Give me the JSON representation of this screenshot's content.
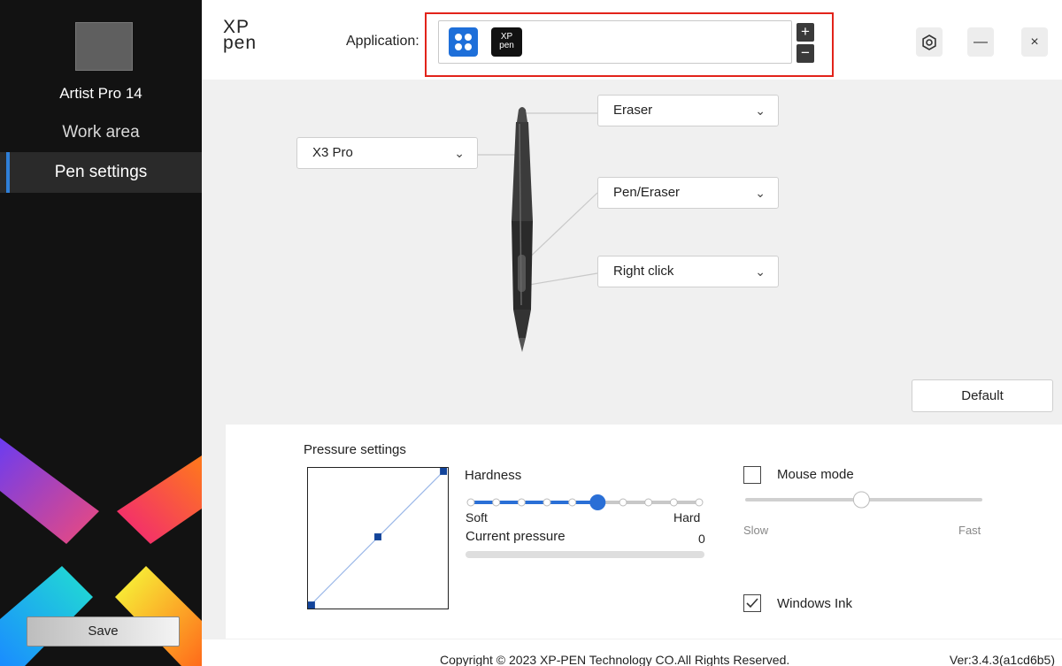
{
  "window": {
    "logo_top": "XP",
    "logo_bottom": "pen",
    "settings_icon": "gear-icon",
    "minimize_label": "—",
    "close_label": "×"
  },
  "sidebar": {
    "device_name": "Artist Pro 14",
    "items": [
      {
        "label": "Work area",
        "active": false
      },
      {
        "label": "Pen settings",
        "active": true
      }
    ],
    "save_label": "Save",
    "active_color": "#2f7fd8"
  },
  "application": {
    "label": "Application:",
    "apps": [
      {
        "name": "all-apps",
        "icon": "all-apps-icon",
        "color": "#1e6fd9"
      },
      {
        "name": "xp-pen",
        "icon": "xppen-app-icon",
        "text_top": "XP",
        "text_bottom": "pen"
      }
    ],
    "add_label": "+",
    "remove_label": "−",
    "highlight_color": "#e2231a"
  },
  "pen": {
    "model": "X3 Pro",
    "top_button": "Eraser",
    "upper_side_button": "Pen/Eraser",
    "lower_side_button": "Right click",
    "default_label": "Default"
  },
  "pressure": {
    "title": "Pressure settings",
    "hardness_label": "Hardness",
    "hardness_steps": 10,
    "hardness_value_step": 5,
    "soft_label": "Soft",
    "hard_label": "Hard",
    "current_pressure_label": "Current pressure",
    "current_pressure_value": "0",
    "current_pressure_fraction": 0
  },
  "options": {
    "mouse_mode_label": "Mouse mode",
    "mouse_mode_checked": false,
    "speed_fraction": 0.49,
    "slow_label": "Slow",
    "fast_label": "Fast",
    "windows_ink_label": "Windows Ink",
    "windows_ink_checked": true
  },
  "footer": {
    "copyright": "Copyright © 2023  XP-PEN Technology CO.All Rights Reserved.",
    "version": "Ver:3.4.3(a1cd6b5)"
  }
}
